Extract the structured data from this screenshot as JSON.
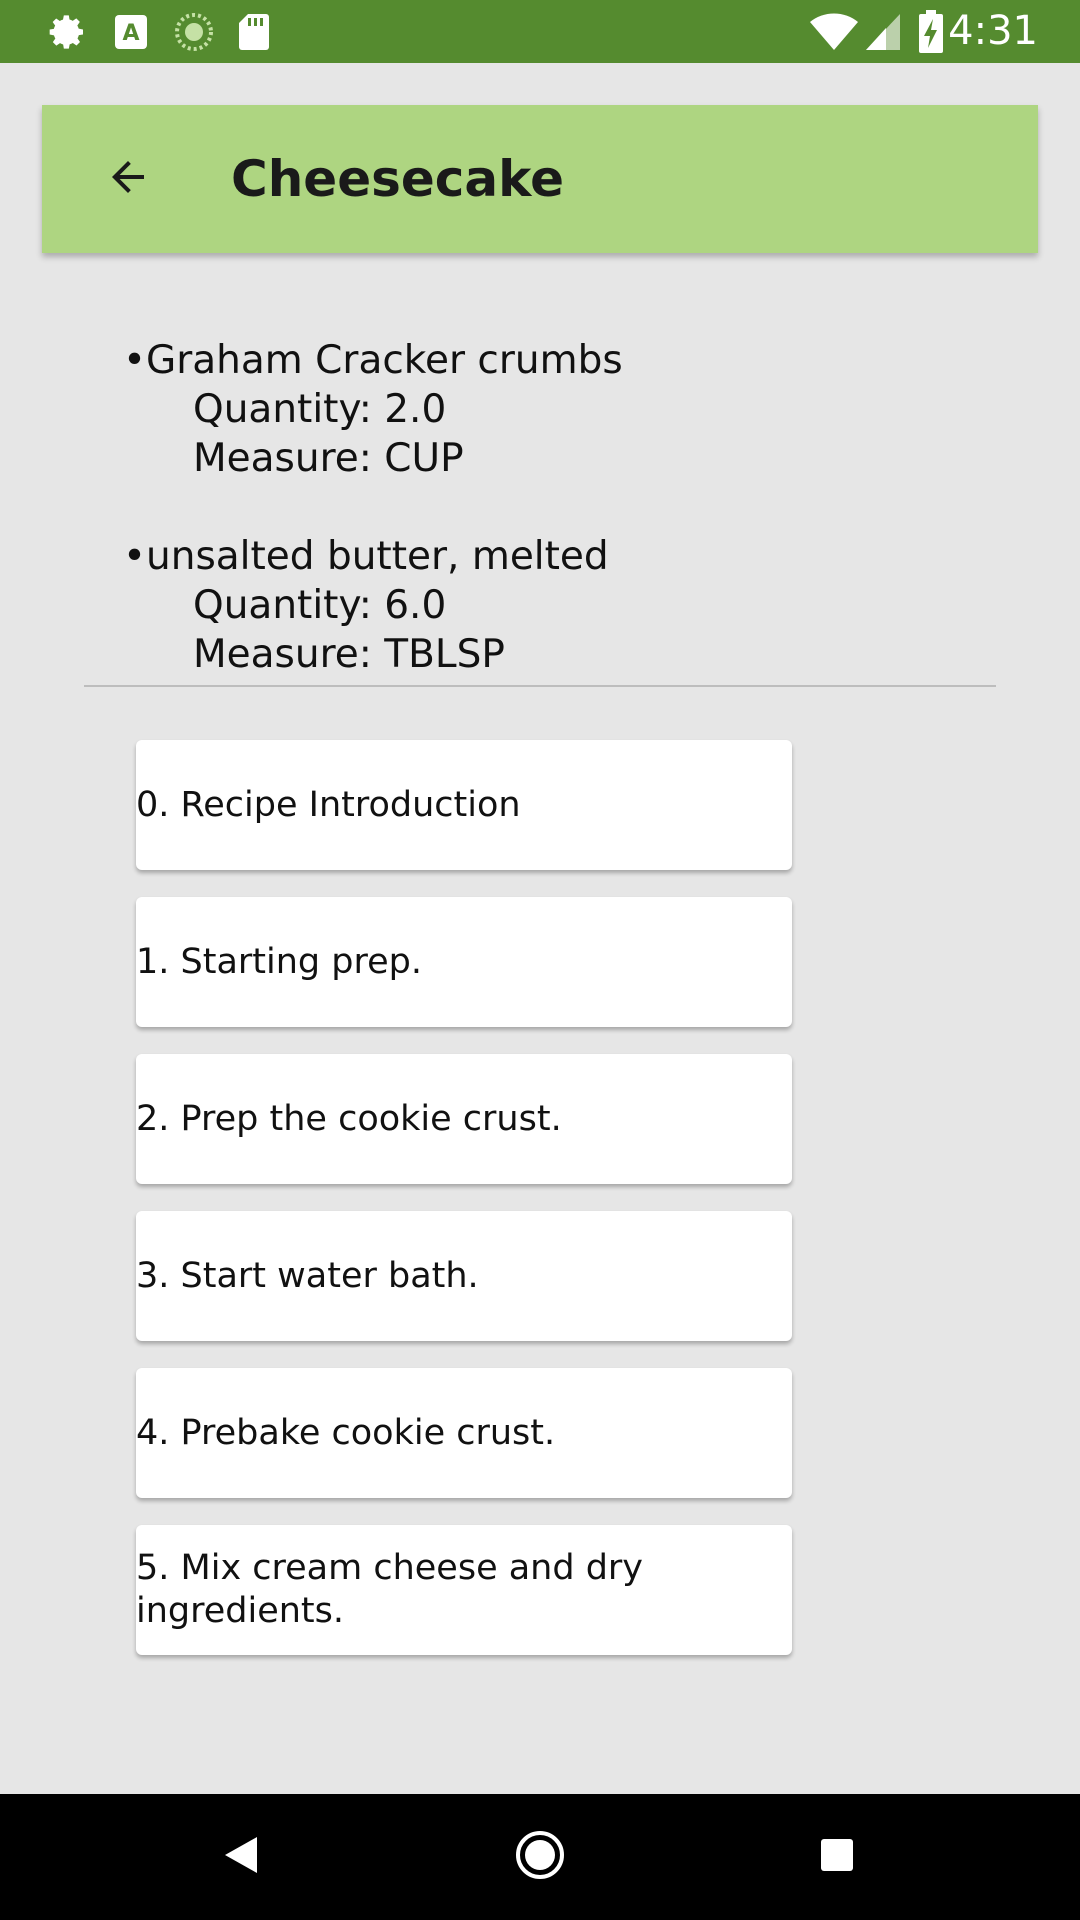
{
  "status_bar": {
    "time": "4:31",
    "icons": [
      "gear-icon",
      "text-a-icon",
      "sync-icon",
      "sd-card-icon",
      "wifi-icon",
      "signal-icon",
      "battery-charging-icon"
    ]
  },
  "toolbar": {
    "title": "Cheesecake",
    "back_icon": "arrow-back-icon"
  },
  "ingredients": [
    {
      "name": "Graham Cracker crumbs",
      "quantity": "Quantity: 2.0",
      "measure": "Measure: CUP"
    },
    {
      "name": "unsalted butter, melted",
      "quantity": "Quantity: 6.0",
      "measure": "Measure: TBLSP"
    }
  ],
  "steps": [
    "0. Recipe Introduction",
    "1. Starting prep.",
    "2. Prep the cookie crust.",
    "3. Start water bath.",
    "4. Prebake cookie crust.",
    "5. Mix cream cheese and dry ingredients."
  ],
  "nav_bar": {
    "icons": [
      "nav-back-icon",
      "nav-home-icon",
      "nav-recents-icon"
    ]
  },
  "colors": {
    "status_bar": "#558b2f",
    "toolbar": "#aed581",
    "background": "#e6e6e6"
  }
}
